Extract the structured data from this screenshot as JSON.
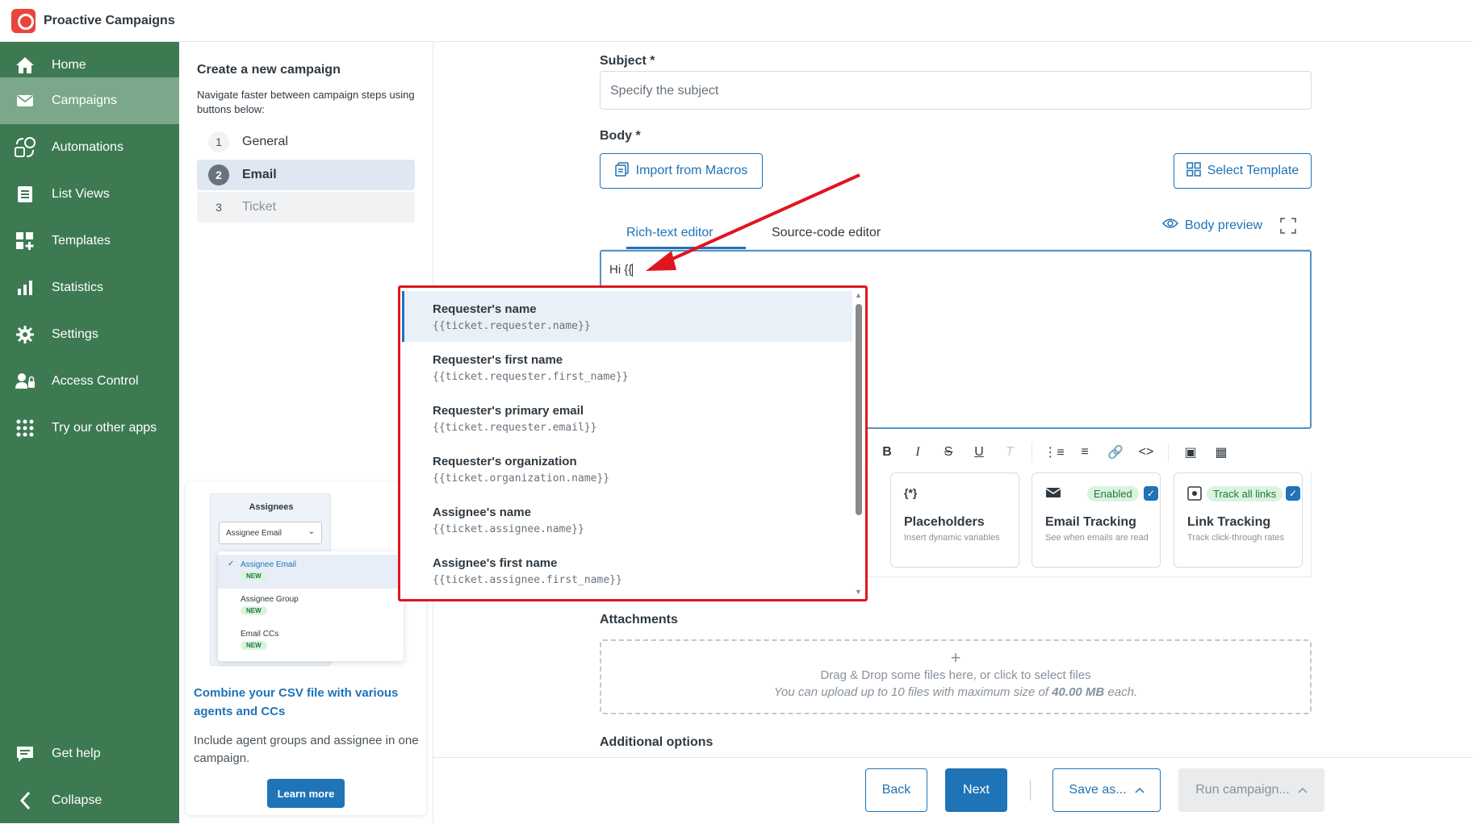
{
  "app": {
    "title": "Proactive Campaigns"
  },
  "sidebar": {
    "items": [
      {
        "label": "Home",
        "icon": "home-icon"
      },
      {
        "label": "Campaigns",
        "icon": "envelope-icon"
      },
      {
        "label": "Automations",
        "icon": "automation-icon"
      },
      {
        "label": "List Views",
        "icon": "list-icon"
      },
      {
        "label": "Templates",
        "icon": "templates-icon"
      },
      {
        "label": "Statistics",
        "icon": "bar-chart-icon"
      },
      {
        "label": "Settings",
        "icon": "gear-icon"
      },
      {
        "label": "Access Control",
        "icon": "user-lock-icon"
      },
      {
        "label": "Try our other apps",
        "icon": "grid-icon"
      }
    ],
    "bottom": [
      {
        "label": "Get help",
        "icon": "chat-icon"
      },
      {
        "label": "Collapse",
        "icon": "chevron-left-icon"
      }
    ],
    "colors": {
      "background": "#3d7a52",
      "active": "#7ba88a"
    }
  },
  "steps": {
    "title": "Create a new campaign",
    "description": "Navigate faster between campaign steps using buttons below:",
    "items": [
      {
        "num": "1",
        "label": "General"
      },
      {
        "num": "2",
        "label": "Email"
      },
      {
        "num": "3",
        "label": "Ticket"
      }
    ]
  },
  "promo": {
    "panel_title": "Assignees",
    "select_value": "Assignee Email",
    "options": [
      {
        "label": "Assignee Email",
        "badge": "NEW"
      },
      {
        "label": "Assignee Group",
        "badge": "NEW"
      },
      {
        "label": "Email CCs",
        "badge": "NEW"
      }
    ],
    "heading": "Combine your CSV file with various agents and CCs",
    "text": "Include agent groups and assignee in one campaign.",
    "button": "Learn more"
  },
  "form": {
    "subject_label": "Subject *",
    "subject_placeholder": "Specify the subject",
    "body_label": "Body *",
    "import_macros": "Import from Macros",
    "select_template": "Select Template",
    "tab_rich": "Rich-text editor",
    "tab_source": "Source-code editor",
    "body_preview": "Body preview",
    "editor_text": "Hi {{",
    "features": [
      {
        "title": "Placeholders",
        "desc": "Insert dynamic variables",
        "icon": "{*}"
      },
      {
        "title": "Email Tracking",
        "desc": "See when emails are read",
        "pill": "Enabled"
      },
      {
        "title": "Link Tracking",
        "desc": "Track click-through rates",
        "pill": "Track all links"
      }
    ],
    "attachments_label": "Attachments",
    "drop_main": "Drag & Drop some files here, or click to select files",
    "drop_hint_prefix": "You can upload up to 10 files with maximum size of ",
    "drop_hint_size": "40.00 MB",
    "drop_hint_suffix": " each.",
    "additional_label": "Additional options"
  },
  "footer": {
    "back": "Back",
    "next": "Next",
    "save": "Save as...",
    "run": "Run campaign..."
  },
  "autocomplete": {
    "items": [
      {
        "name": "Requester's name",
        "code": "{{ticket.requester.name}}"
      },
      {
        "name": "Requester's first name",
        "code": "{{ticket.requester.first_name}}"
      },
      {
        "name": "Requester's primary email",
        "code": "{{ticket.requester.email}}"
      },
      {
        "name": "Requester's organization",
        "code": "{{ticket.organization.name}}"
      },
      {
        "name": "Assignee's name",
        "code": "{{ticket.assignee.name}}"
      },
      {
        "name": "Assignee's first name",
        "code": "{{ticket.assignee.first_name}}"
      }
    ]
  },
  "colors": {
    "accent": "#1f73b7",
    "highlight": "#e0161e"
  }
}
